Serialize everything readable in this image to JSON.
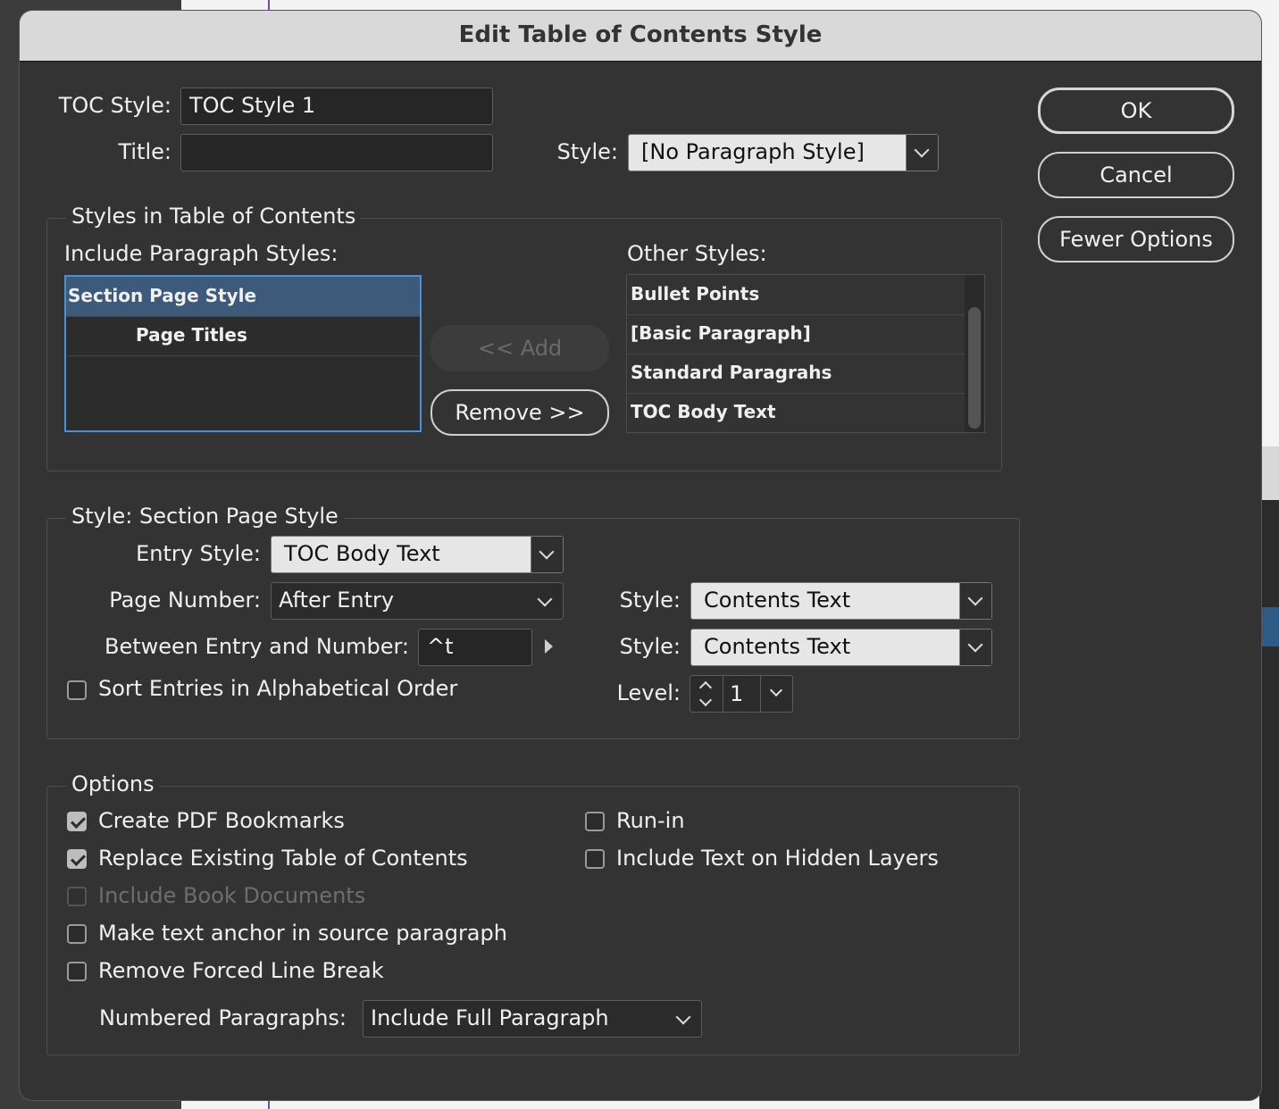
{
  "dialog": {
    "title": "Edit Table of Contents Style",
    "toc_style_label": "TOC Style:",
    "toc_style_value": "TOC Style 1",
    "title_label": "Title:",
    "title_value": "",
    "style_label": "Style:",
    "title_style_value": "[No Paragraph Style]"
  },
  "buttons": {
    "ok": "OK",
    "cancel": "Cancel",
    "fewer_options": "Fewer Options",
    "add": "<< Add",
    "remove": "Remove >>"
  },
  "styles_group": {
    "legend": "Styles in Table of Contents",
    "include_label": "Include Paragraph Styles:",
    "include_items": [
      "Section Page Style",
      "Page Titles"
    ],
    "selected_item": "Section Page Style",
    "other_label": "Other Styles:",
    "other_items": [
      "Bullet Points",
      "[Basic Paragraph]",
      "Standard Paragrahs",
      "TOC Body Text"
    ]
  },
  "entry_group": {
    "legend": "Style: Section Page Style",
    "entry_style_label": "Entry Style:",
    "entry_style_value": "TOC Body Text",
    "page_number_label": "Page Number:",
    "page_number_value": "After Entry",
    "page_number_style_label": "Style:",
    "page_number_style_value": "Contents Text",
    "between_label": "Between Entry and Number:",
    "between_value": "^t",
    "between_style_label": "Style:",
    "between_style_value": "Contents Text",
    "sort_label": "Sort Entries in Alphabetical Order",
    "sort_checked": false,
    "level_label": "Level:",
    "level_value": "1"
  },
  "options_group": {
    "legend": "Options",
    "create_pdf_bookmarks": {
      "label": "Create PDF Bookmarks",
      "checked": true
    },
    "replace_existing_toc": {
      "label": "Replace Existing Table of Contents",
      "checked": true
    },
    "include_book_documents": {
      "label": "Include Book Documents",
      "checked": false,
      "disabled": true
    },
    "make_text_anchor": {
      "label": "Make text anchor in source paragraph",
      "checked": false
    },
    "remove_forced_line_break": {
      "label": "Remove Forced Line Break",
      "checked": false
    },
    "run_in": {
      "label": "Run-in",
      "checked": false
    },
    "include_hidden_layers": {
      "label": "Include Text on Hidden Layers",
      "checked": false
    },
    "numbered_paragraphs_label": "Numbered Paragraphs:",
    "numbered_paragraphs_value": "Include Full Paragraph"
  },
  "colors": {
    "dialog_bg": "#333333",
    "titlebar_bg": "#d9d9d9",
    "selection_bg": "#3d5a7a",
    "focus_border": "#4a90d9"
  }
}
